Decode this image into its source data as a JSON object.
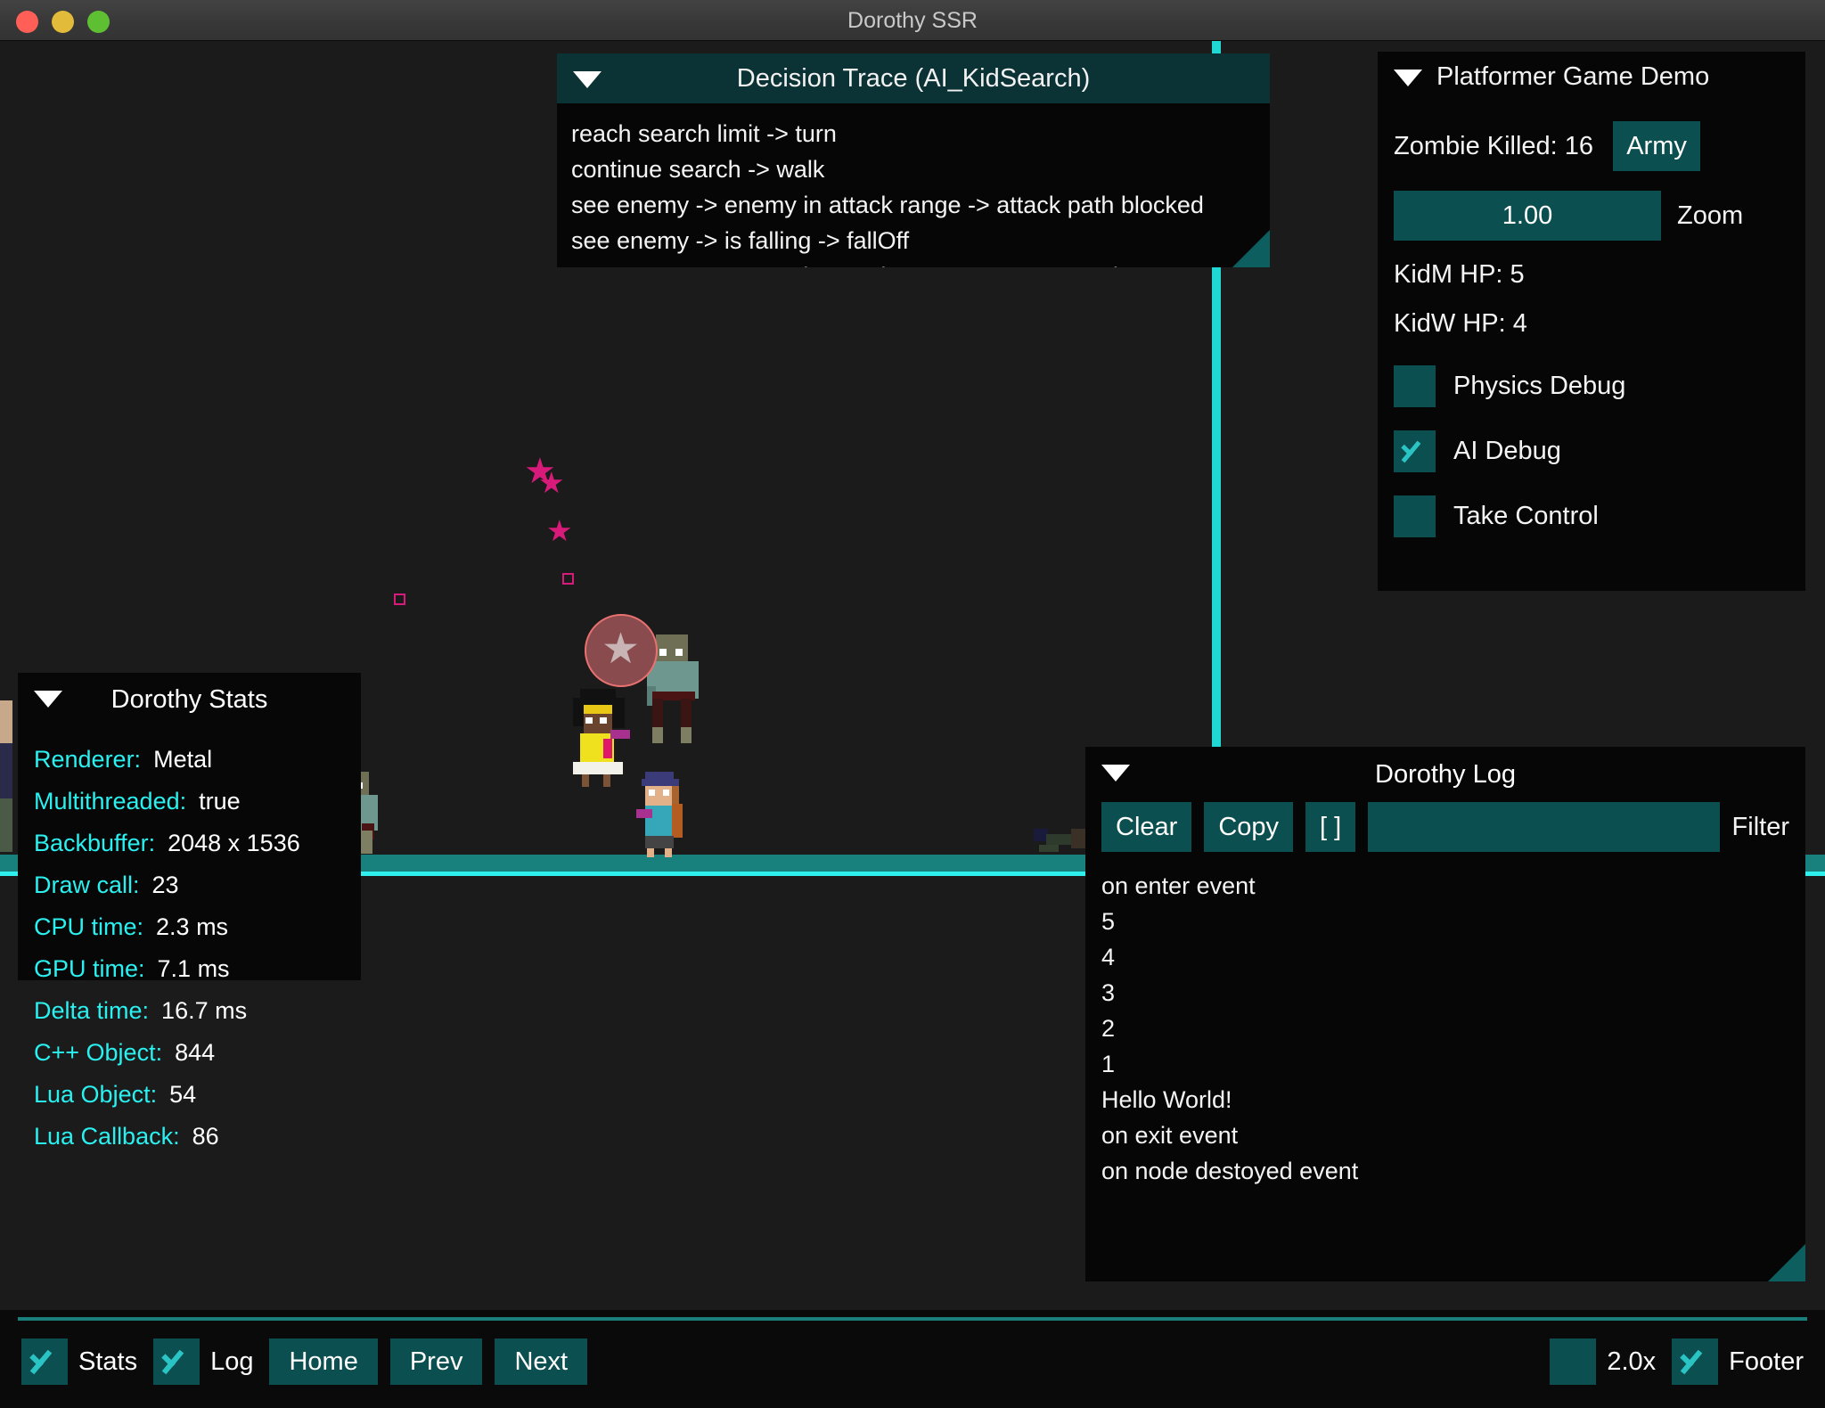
{
  "window": {
    "title": "Dorothy SSR",
    "traffic_lights": [
      "close",
      "minimize",
      "maximize"
    ]
  },
  "decision_trace": {
    "title": "Decision Trace (AI_KidSearch)",
    "collapse_icon": "caret-down-icon",
    "lines": [
      "reach search limit -> turn",
      "continue search -> walk",
      "see enemy -> enemy in attack range -> attack path blocked",
      "see enemy -> is falling -> fallOff",
      "see enemy -> enemy in attack range -> rangeAttack"
    ]
  },
  "platformer": {
    "title": "Platformer Game Demo",
    "collapse_icon": "caret-down-icon",
    "zombie_killed_label": "Zombie Killed: 16",
    "army_button": "Army",
    "zoom_value": "1.00",
    "zoom_label": "Zoom",
    "kidm_hp": "KidM HP: 5",
    "kidw_hp": "KidW HP: 4",
    "checkboxes": [
      {
        "label": "Physics Debug",
        "checked": false
      },
      {
        "label": "AI Debug",
        "checked": true
      },
      {
        "label": "Take Control",
        "checked": false
      }
    ]
  },
  "dorothy_stats": {
    "title": "Dorothy Stats",
    "collapse_icon": "caret-down-icon",
    "rows": [
      {
        "key": "Renderer:",
        "value": "Metal"
      },
      {
        "key": "Multithreaded:",
        "value": "true"
      },
      {
        "key": "Backbuffer:",
        "value": "2048 x 1536"
      },
      {
        "key": "Draw call:",
        "value": "23"
      },
      {
        "key": "CPU time:",
        "value": "2.3 ms"
      },
      {
        "key": "GPU time:",
        "value": "7.1 ms"
      },
      {
        "key": "Delta time:",
        "value": "16.7 ms"
      },
      {
        "key": "C++ Object:",
        "value": "844"
      },
      {
        "key": "Lua Object:",
        "value": "54"
      },
      {
        "key": "Lua Callback:",
        "value": "86"
      }
    ]
  },
  "dorothy_log": {
    "title": "Dorothy Log",
    "collapse_icon": "caret-down-icon",
    "clear_button": "Clear",
    "copy_button": "Copy",
    "bracket_button": "[ ]",
    "filter_value": "",
    "filter_placeholder": "",
    "filter_label": "Filter",
    "lines": [
      "on enter event",
      "5",
      "4",
      "3",
      "2",
      "1",
      "Hello World!",
      "on exit event",
      "on node destoyed event"
    ]
  },
  "footer": {
    "stats_label": "Stats",
    "stats_checked": true,
    "log_label": "Log",
    "log_checked": true,
    "home_button": "Home",
    "prev_button": "Prev",
    "next_button": "Next",
    "scale_label": "2.0x",
    "scale_checked": false,
    "footer_label": "Footer",
    "footer_checked": true
  },
  "colors": {
    "accent_teal": "#0c4f50",
    "accent_cyan": "#2bf0f0",
    "ground": "#18807d",
    "panel_bg": "#060606"
  }
}
